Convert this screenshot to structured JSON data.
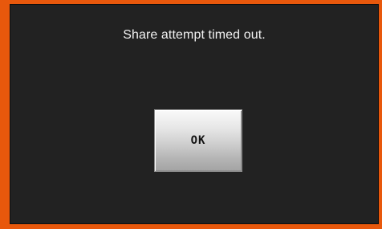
{
  "dialog": {
    "message": "Share attempt timed out.",
    "ok_label": "OK"
  },
  "colors": {
    "frame": "#e8580c",
    "background": "#222222",
    "text": "#f2f2f2",
    "button_face": "#d0d0d0"
  }
}
